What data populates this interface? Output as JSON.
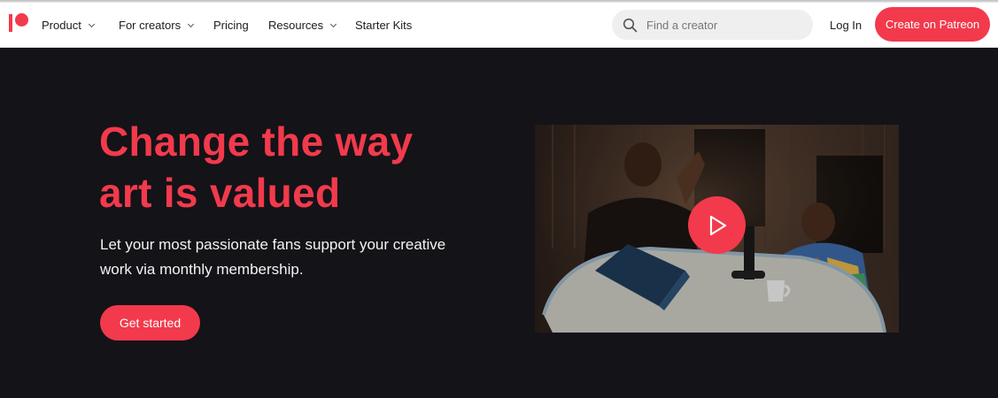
{
  "nav": {
    "items": [
      {
        "label": "Product",
        "has_dropdown": true
      },
      {
        "label": "For creators",
        "has_dropdown": true
      },
      {
        "label": "Pricing",
        "has_dropdown": false
      },
      {
        "label": "Resources",
        "has_dropdown": true
      },
      {
        "label": "Starter Kits",
        "has_dropdown": false
      }
    ],
    "search": {
      "placeholder": "Find a creator",
      "icon": "search-icon"
    },
    "login_label": "Log In",
    "create_label": "Create on Patreon"
  },
  "hero": {
    "headline_line1": "Change the way",
    "headline_line2": "art is valued",
    "subtext": "Let your most passionate fans support your creative work via monthly membership.",
    "cta_label": "Get started",
    "video": {
      "play_icon": "play-icon"
    }
  },
  "colors": {
    "brand": "#f23a4c",
    "hero_background": "#141318",
    "nav_background": "#ffffff"
  }
}
